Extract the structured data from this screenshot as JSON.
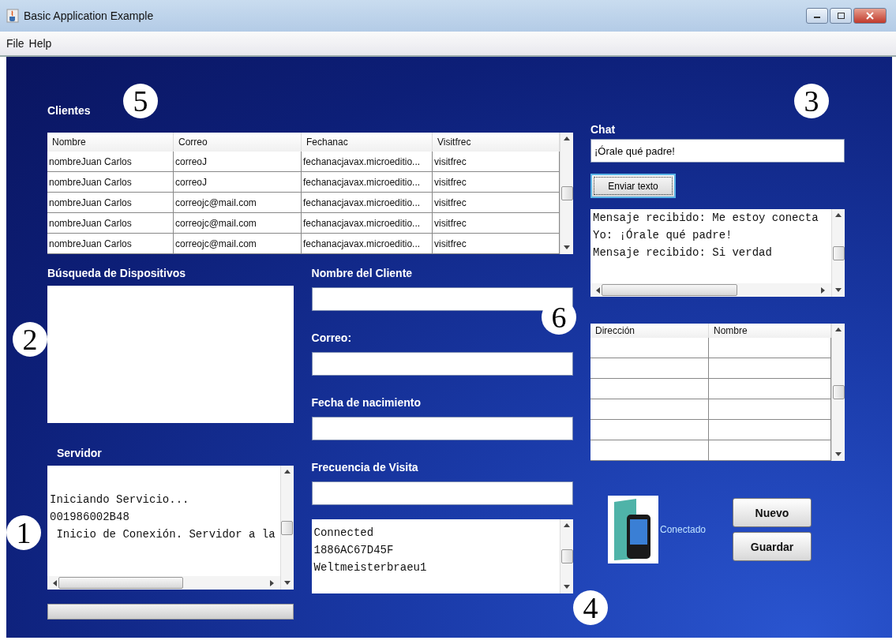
{
  "window": {
    "title": "Basic Application Example"
  },
  "menu": [
    "File",
    "Help"
  ],
  "clientes": {
    "title": "Clientes",
    "columns": [
      "Nombre",
      "Correo",
      "Fechanac",
      "Visitfrec"
    ],
    "rows": [
      [
        "nombreJuan Carlos",
        "correoJ",
        "fechanacjavax.microeditio...",
        "visitfrec"
      ],
      [
        "nombreJuan Carlos",
        "correoJ",
        "fechanacjavax.microeditio...",
        "visitfrec"
      ],
      [
        "nombreJuan Carlos",
        "correojc@mail.com",
        "fechanacjavax.microeditio...",
        "visitfrec"
      ],
      [
        "nombreJuan Carlos",
        "correojc@mail.com",
        "fechanacjavax.microeditio...",
        "visitfrec"
      ],
      [
        "nombreJuan Carlos",
        "correojc@mail.com",
        "fechanacjavax.microeditio...",
        "visitfrec"
      ]
    ]
  },
  "busqueda": {
    "title": "Búsqueda de Dispositivos"
  },
  "servidor": {
    "title": "Servidor",
    "lines": [
      "Iniciando Servicio...",
      "001986002B48",
      " Inicio de Conexión. Servidor a la"
    ],
    "progress": {
      "level": 0
    }
  },
  "form": {
    "fields": [
      {
        "label": "Nombre del Cliente"
      },
      {
        "label": "Correo:"
      },
      {
        "label": "Fecha de nacimiento"
      },
      {
        "label": "Frecuencia de Visita"
      }
    ],
    "log": [
      "Connected",
      "1886AC67D45F",
      "Weltmeisterbraeu1"
    ]
  },
  "chat": {
    "title": "Chat",
    "input": "¡Órale qué padre!",
    "send": "Enviar texto",
    "messages": [
      "Mensaje recibido: Me estoy conecta",
      "Yo: ¡Órale qué padre!",
      "Mensaje recibido: Si verdad"
    ]
  },
  "devices": {
    "columns": [
      "Dirección",
      "Nombre"
    ]
  },
  "status": {
    "label": "Conectado"
  },
  "buttons": [
    "Nuevo",
    "Guardar"
  ],
  "annotations": [
    "5",
    "3",
    "2",
    "6",
    "1",
    "4"
  ]
}
